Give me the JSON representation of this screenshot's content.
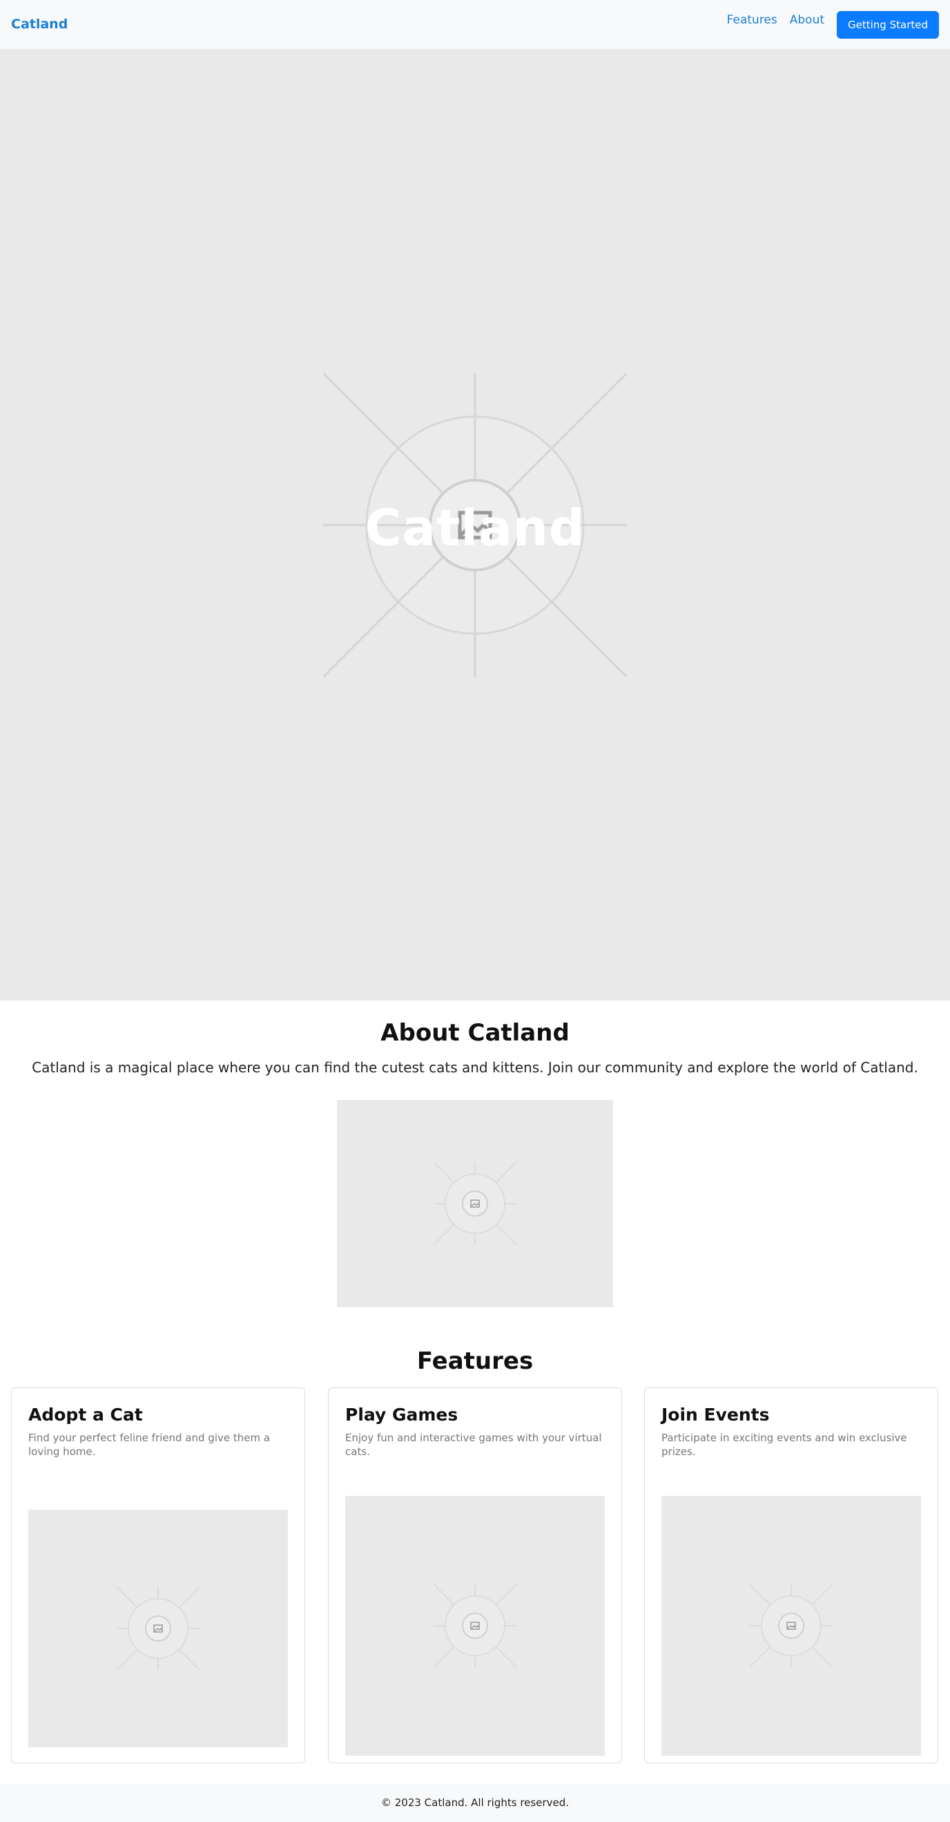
{
  "navbar": {
    "brand": "Catland",
    "links": [
      "Features",
      "About"
    ],
    "cta_label": "Getting Started"
  },
  "hero": {
    "title": "Catland"
  },
  "about": {
    "title": "About Catland",
    "text": "Catland is a magical place where you can find the cutest cats and kittens. Join our community and explore the world of Catland."
  },
  "features": {
    "title": "Features",
    "cards": [
      {
        "title": "Adopt a Cat",
        "text": "Find your perfect feline friend and give them a loving home."
      },
      {
        "title": "Play Games",
        "text": "Enjoy fun and interactive games with your virtual cats."
      },
      {
        "title": "Join Events",
        "text": "Participate in exciting events and win exclusive prizes."
      }
    ]
  },
  "footer": {
    "text": "© 2023 Catland. All rights reserved."
  },
  "colors": {
    "brand": "#1a7fd4",
    "button": "#0b7bff",
    "placeholder": "#e9e9e9"
  }
}
